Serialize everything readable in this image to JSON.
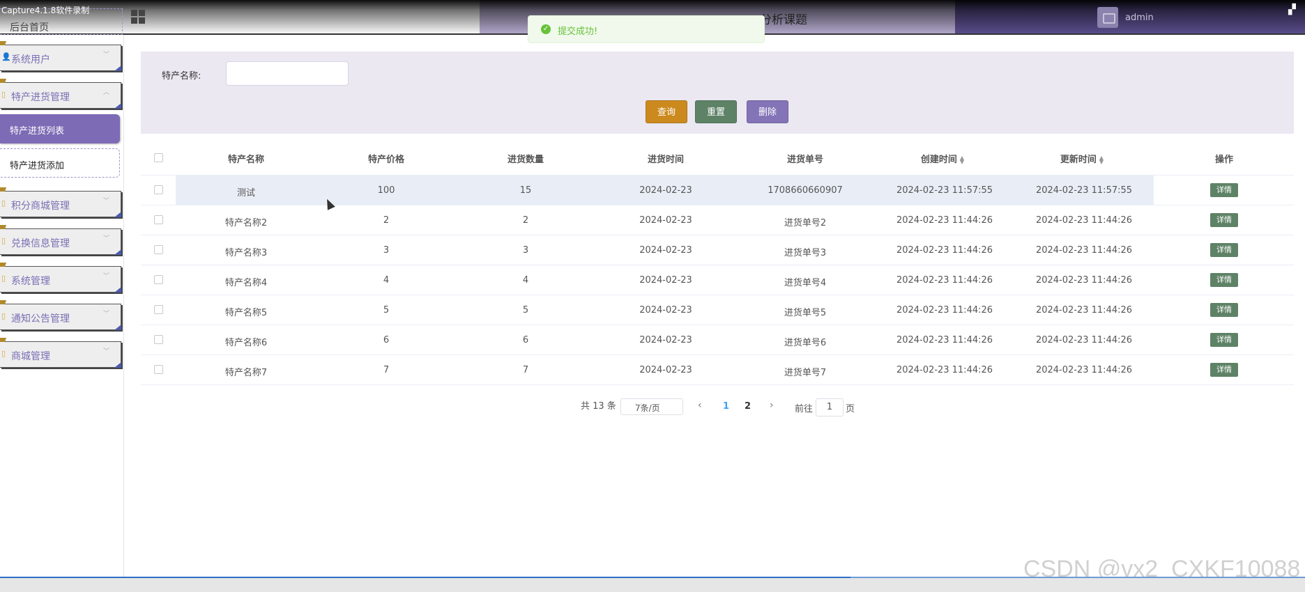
{
  "capture_label": "Capture4.1.8软件录制",
  "header": {
    "home_label": "后台首页",
    "title": "分析课题",
    "username": "admin"
  },
  "toast": {
    "message": "提交成功!"
  },
  "sidebar": {
    "items": [
      {
        "label": "系统用户"
      },
      {
        "label": "特产进货管理"
      },
      {
        "label": "积分商城管理"
      },
      {
        "label": "兑换信息管理"
      },
      {
        "label": "系统管理"
      },
      {
        "label": "通知公告管理"
      },
      {
        "label": "商城管理"
      }
    ],
    "sub_items": [
      {
        "label": "特产进货列表"
      },
      {
        "label": "特产进货添加"
      }
    ]
  },
  "search": {
    "label": "特产名称:",
    "value": "",
    "buttons": {
      "query": "查询",
      "reset": "重置",
      "delete": "删除"
    }
  },
  "table": {
    "columns": [
      "特产名称",
      "特产价格",
      "进货数量",
      "进货时间",
      "进货单号",
      "创建时间",
      "更新时间",
      "操作"
    ],
    "action_label": "详情",
    "rows": [
      [
        "测试",
        "100",
        "15",
        "2024-02-23",
        "1708660660907",
        "2024-02-23 11:57:55",
        "2024-02-23 11:57:55"
      ],
      [
        "特产名称2",
        "2",
        "2",
        "2024-02-23",
        "进货单号2",
        "2024-02-23 11:44:26",
        "2024-02-23 11:44:26"
      ],
      [
        "特产名称3",
        "3",
        "3",
        "2024-02-23",
        "进货单号3",
        "2024-02-23 11:44:26",
        "2024-02-23 11:44:26"
      ],
      [
        "特产名称4",
        "4",
        "4",
        "2024-02-23",
        "进货单号4",
        "2024-02-23 11:44:26",
        "2024-02-23 11:44:26"
      ],
      [
        "特产名称5",
        "5",
        "5",
        "2024-02-23",
        "进货单号5",
        "2024-02-23 11:44:26",
        "2024-02-23 11:44:26"
      ],
      [
        "特产名称6",
        "6",
        "6",
        "2024-02-23",
        "进货单号6",
        "2024-02-23 11:44:26",
        "2024-02-23 11:44:26"
      ],
      [
        "特产名称7",
        "7",
        "7",
        "2024-02-23",
        "进货单号7",
        "2024-02-23 11:44:26",
        "2024-02-23 11:44:26"
      ]
    ]
  },
  "pagination": {
    "total": "共 13 条",
    "page_size": "7条/页",
    "pages": [
      "1",
      "2"
    ],
    "current": "1",
    "goto_prefix": "前往",
    "goto_value": "1",
    "goto_suffix": "页"
  },
  "watermark": "CSDN @vx2_CXKF10088",
  "colors": {
    "accent": "#7d6bb5",
    "query": "#cc8a1e",
    "reset": "#5e8266",
    "delete": "#8474b7",
    "success": "#67c23a"
  }
}
